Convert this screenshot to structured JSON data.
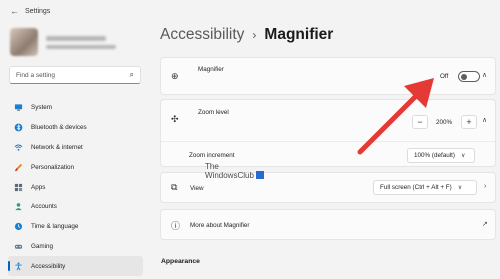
{
  "window": {
    "title": "Settings"
  },
  "search": {
    "placeholder": "Find a setting"
  },
  "sidebar": {
    "items": [
      {
        "label": "System",
        "icon": "monitor-icon",
        "active": false
      },
      {
        "label": "Bluetooth & devices",
        "icon": "bluetooth-icon",
        "active": false
      },
      {
        "label": "Network & internet",
        "icon": "wifi-icon",
        "active": false
      },
      {
        "label": "Personalization",
        "icon": "brush-icon",
        "active": false
      },
      {
        "label": "Apps",
        "icon": "apps-grid-icon",
        "active": false
      },
      {
        "label": "Accounts",
        "icon": "person-icon",
        "active": false
      },
      {
        "label": "Time & language",
        "icon": "globe-clock-icon",
        "active": false
      },
      {
        "label": "Gaming",
        "icon": "gamepad-icon",
        "active": false
      },
      {
        "label": "Accessibility",
        "icon": "accessibility-icon",
        "active": true
      }
    ]
  },
  "breadcrumb": {
    "parent": "Accessibility",
    "separator": "›",
    "current": "Magnifier"
  },
  "magnifier": {
    "label": "Magnifier",
    "state": "Off"
  },
  "zoom": {
    "level_label": "Zoom level",
    "minus": "−",
    "value": "200%",
    "plus": "+",
    "increment_label": "Zoom increment",
    "increment_value": "100% (default)"
  },
  "view": {
    "label": "View",
    "value": "Full screen (Ctrl + Alt + F)"
  },
  "more": {
    "label": "More about Magnifier"
  },
  "appearance": {
    "heading": "Appearance"
  },
  "watermark": {
    "line1": "The",
    "line2": "WindowsClub"
  },
  "colors": {
    "accent": "#0067c0",
    "arrow": "#e53935",
    "background": "#f3f3f3",
    "card": "#fbfbfb"
  }
}
